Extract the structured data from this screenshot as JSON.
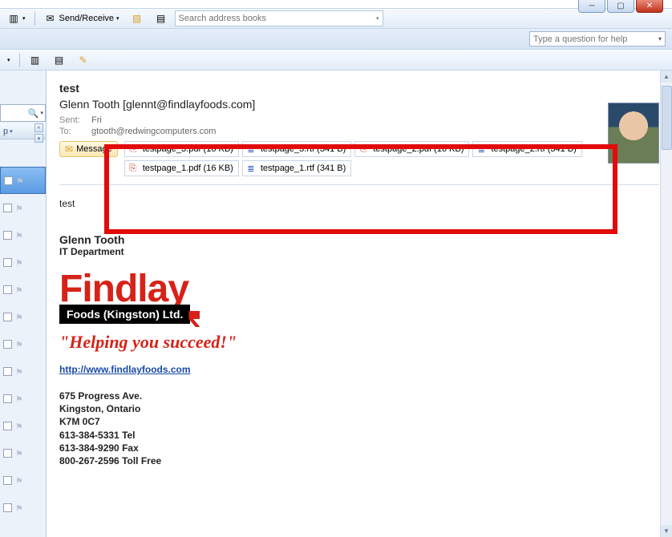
{
  "toolbar": {
    "send_receive": "Send/Receive",
    "search_placeholder": "Search address books"
  },
  "help_placeholder": "Type a question for help",
  "left": {
    "group": "p"
  },
  "message": {
    "subject": "test",
    "from": "Glenn Tooth [glennt@findlayfoods.com]",
    "sent_label": "Sent:",
    "sent_value": "Fri",
    "to_label": "To:",
    "to_value": "gtooth@redwingcomputers.com",
    "attach_tab": "Message",
    "attachments": [
      {
        "name": "testpage_3.pdf",
        "size": "(16 KB)",
        "type": "pdf"
      },
      {
        "name": "testpage_3.rtf",
        "size": "(341 B)",
        "type": "rtf"
      },
      {
        "name": "testpage_2.pdf",
        "size": "(16 KB)",
        "type": "pdf"
      },
      {
        "name": "testpage_2.rtf",
        "size": "(341 B)",
        "type": "rtf"
      },
      {
        "name": "testpage_1.pdf",
        "size": "(16 KB)",
        "type": "pdf"
      },
      {
        "name": "testpage_1.rtf",
        "size": "(341 B)",
        "type": "rtf"
      }
    ],
    "body_text": "test"
  },
  "signature": {
    "name": "Glenn Tooth",
    "dept": "IT Department",
    "logo_main": "Findlay",
    "logo_sub": "Foods (Kingston) Ltd.",
    "tagline": "\"Helping you succeed!\"",
    "website": "http://www.findlayfoods.com",
    "addr1": "675 Progress Ave.",
    "addr2": "Kingston, Ontario",
    "addr3": "K7M 0C7",
    "tel": "613-384-5331 Tel",
    "fax": "613-384-9290 Fax",
    "tollfree": "800-267-2596 Toll Free"
  }
}
